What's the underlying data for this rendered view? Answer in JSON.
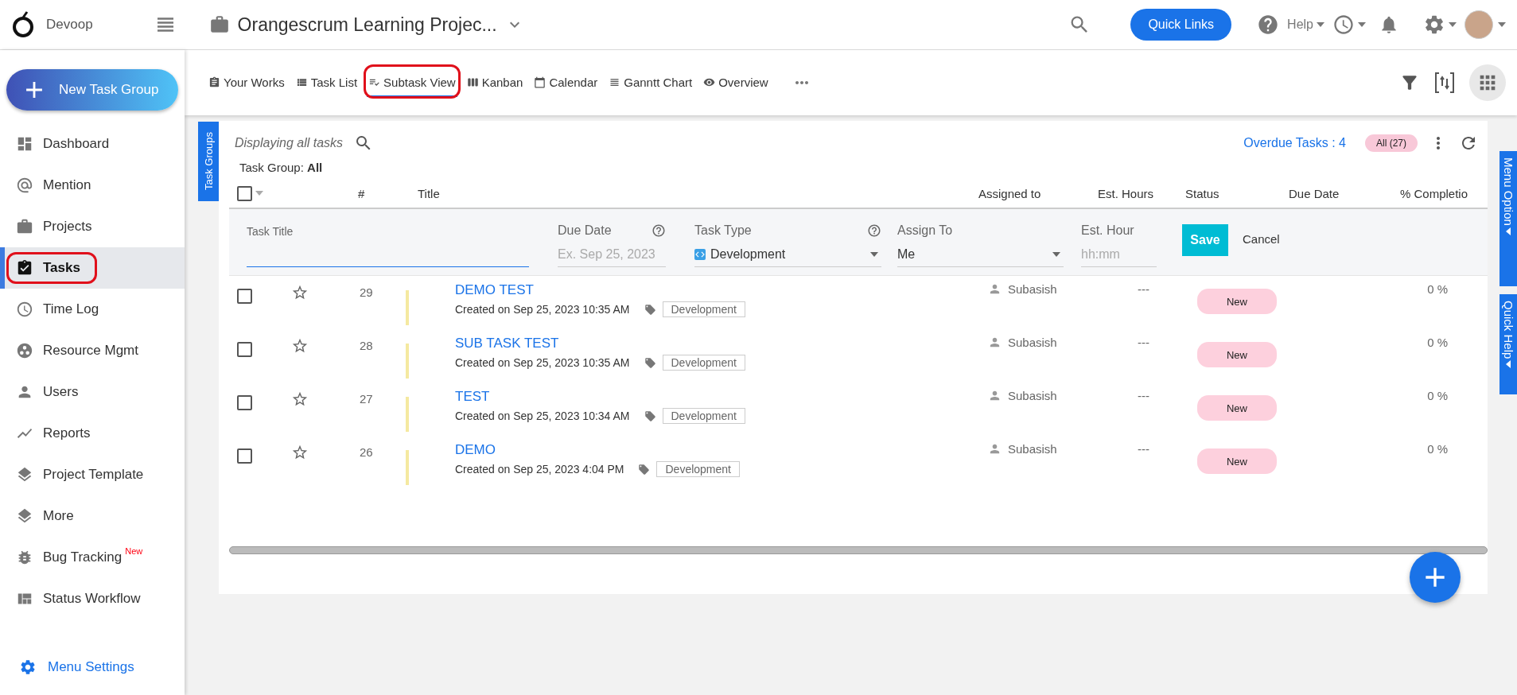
{
  "header": {
    "brand": "Devoop",
    "project_title": "Orangescrum Learning Projec...",
    "quick_links": "Quick Links",
    "help": "Help"
  },
  "sidebar": {
    "new_button": "New Task Group",
    "items": [
      {
        "label": "Dashboard",
        "selected": false,
        "annotated": false
      },
      {
        "label": "Mention",
        "selected": false,
        "annotated": false
      },
      {
        "label": "Projects",
        "selected": false,
        "annotated": false
      },
      {
        "label": "Tasks",
        "selected": true,
        "annotated": true
      },
      {
        "label": "Time Log",
        "selected": false,
        "annotated": false
      },
      {
        "label": "Resource Mgmt",
        "selected": false,
        "annotated": false
      },
      {
        "label": "Users",
        "selected": false,
        "annotated": false
      },
      {
        "label": "Reports",
        "selected": false,
        "annotated": false
      },
      {
        "label": "Project Template",
        "selected": false,
        "annotated": false
      },
      {
        "label": "More",
        "selected": false,
        "annotated": false
      },
      {
        "label": "Bug Tracking",
        "selected": false,
        "annotated": false,
        "badge": "New"
      },
      {
        "label": "Status Workflow",
        "selected": false,
        "annotated": false
      }
    ],
    "menu_settings": "Menu Settings"
  },
  "view_tabs": [
    {
      "label": "Your Works",
      "selected": false,
      "annotated": false
    },
    {
      "label": "Task List",
      "selected": false,
      "annotated": false
    },
    {
      "label": "Subtask View",
      "selected": true,
      "annotated": true
    },
    {
      "label": "Kanban",
      "selected": false,
      "annotated": false
    },
    {
      "label": "Calendar",
      "selected": false,
      "annotated": false
    },
    {
      "label": "Ganntt Chart",
      "selected": false,
      "annotated": false
    },
    {
      "label": "Overview",
      "selected": false,
      "annotated": false
    }
  ],
  "side_tabs": {
    "left": "Task Groups",
    "right": [
      "Menu Option",
      "Quick Help"
    ]
  },
  "panel": {
    "displaying": "Displaying all tasks",
    "overdue": "Overdue Tasks : 4",
    "filter_badge": "All (27)",
    "task_group_label": "Task Group:",
    "task_group_value": "All"
  },
  "table": {
    "select_all_checked": false,
    "columns": [
      "#",
      "Title",
      "Assigned to",
      "Est. Hours",
      "Status",
      "Due Date",
      "% Completio"
    ],
    "new_task_form": {
      "task_title": {
        "label": "Task Title"
      },
      "due_date": {
        "label": "Due Date",
        "placeholder": "Ex. Sep 25, 2023"
      },
      "task_type": {
        "label": "Task Type",
        "value": "Development"
      },
      "assign_to": {
        "label": "Assign To",
        "value": "Me"
      },
      "est_hour": {
        "label": "Est. Hour",
        "placeholder": "hh:mm"
      },
      "save": "Save",
      "cancel": "Cancel"
    },
    "rows": [
      {
        "checked": false,
        "starred": false,
        "number": "29",
        "title": "DEMO TEST",
        "created": "Created on Sep 25, 2023 10:35 AM",
        "tag": "Development",
        "assigned": "Subasish",
        "est_hours": "---",
        "status": "New",
        "completion": "0 %"
      },
      {
        "checked": false,
        "starred": false,
        "number": "28",
        "title": "SUB TASK TEST",
        "created": "Created on Sep 25, 2023 10:35 AM",
        "tag": "Development",
        "assigned": "Subasish",
        "est_hours": "---",
        "status": "New",
        "completion": "0 %"
      },
      {
        "checked": false,
        "starred": false,
        "number": "27",
        "title": "TEST",
        "created": "Created on Sep 25, 2023 10:34 AM",
        "tag": "Development",
        "assigned": "Subasish",
        "est_hours": "---",
        "status": "New",
        "completion": "0 %"
      },
      {
        "checked": false,
        "starred": false,
        "number": "26",
        "title": "DEMO",
        "created": "Created on Sep 25, 2023 4:04 PM",
        "tag": "Development",
        "assigned": "Subasish",
        "est_hours": "---",
        "status": "New",
        "completion": "0 %"
      }
    ]
  }
}
